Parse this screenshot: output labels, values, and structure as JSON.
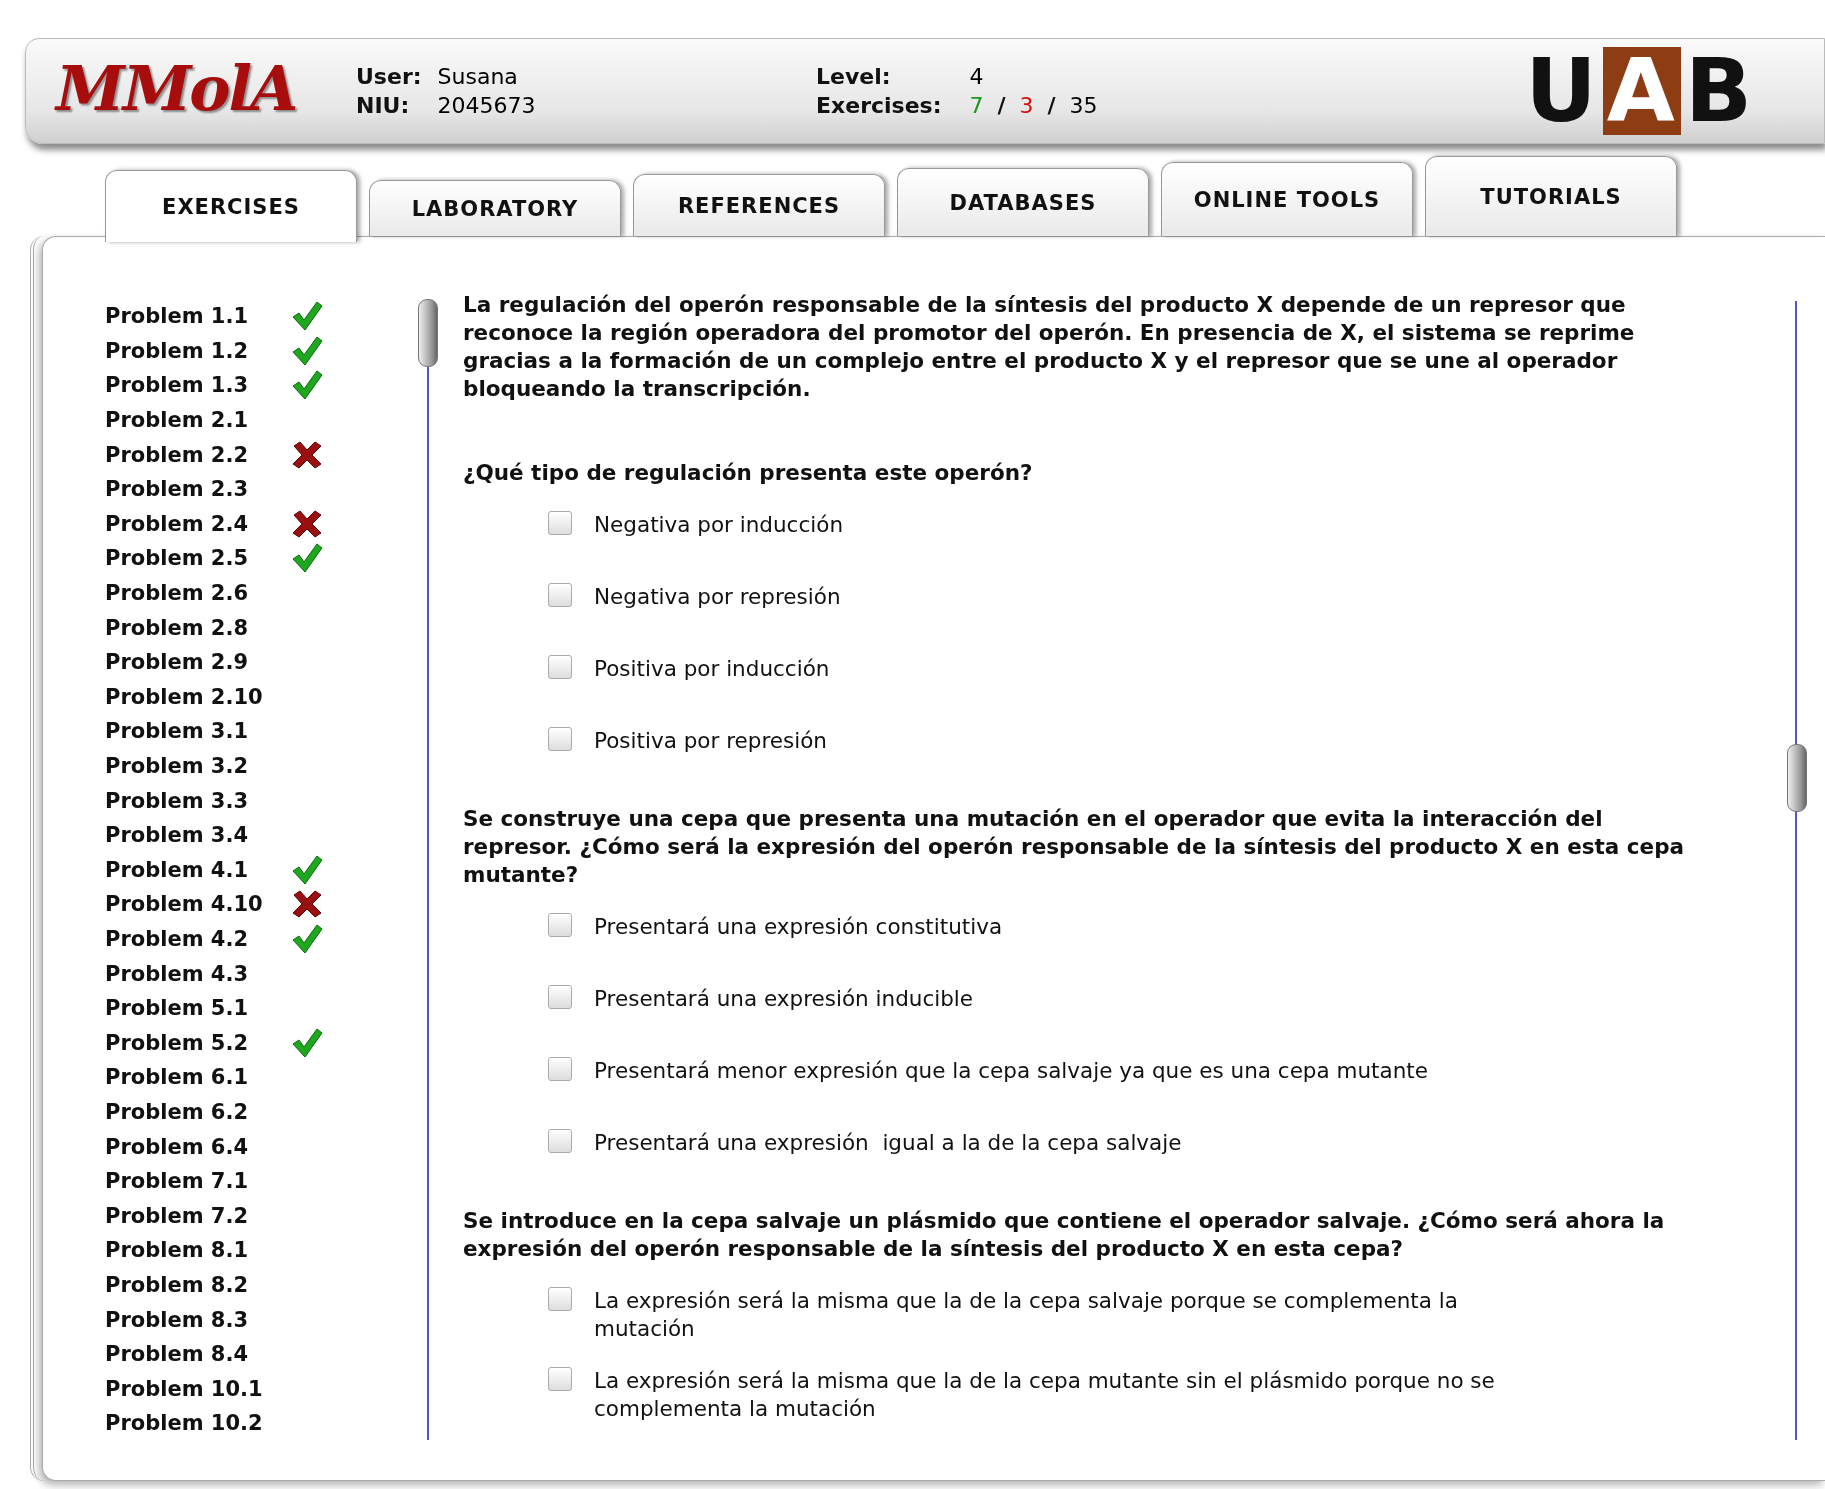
{
  "header": {
    "logo": "MMolA",
    "user_label": "User:",
    "user": "Susana",
    "niu_label": "NIU:",
    "niu": "2045673",
    "level_label": "Level:",
    "level_value": "4",
    "exercises_label": "Exercises:",
    "correct": "7",
    "wrong": "3",
    "total": "35",
    "sep1": "/",
    "sep2": "/",
    "brand": "UAB"
  },
  "tabs": [
    {
      "label": "EXERCISES",
      "selected": true
    },
    {
      "label": "LABORATORY",
      "selected": false
    },
    {
      "label": "REFERENCES",
      "selected": false
    },
    {
      "label": "DATABASES",
      "selected": false
    },
    {
      "label": "ONLINE TOOLS",
      "selected": false
    },
    {
      "label": "TUTORIALS",
      "selected": false
    }
  ],
  "problems": [
    {
      "label": "Problem 1.1",
      "kind": "correct"
    },
    {
      "label": "Problem 1.2",
      "kind": "correct"
    },
    {
      "label": "Problem 1.3",
      "kind": "correct"
    },
    {
      "label": "Problem 2.1",
      "kind": "none"
    },
    {
      "label": "Problem 2.2",
      "kind": "wrong"
    },
    {
      "label": "Problem 2.3",
      "kind": "none"
    },
    {
      "label": "Problem 2.4",
      "kind": "wrong"
    },
    {
      "label": "Problem 2.5",
      "kind": "correct"
    },
    {
      "label": "Problem 2.6",
      "kind": "none"
    },
    {
      "label": "Problem 2.8",
      "kind": "none"
    },
    {
      "label": "Problem 2.9",
      "kind": "none"
    },
    {
      "label": "Problem 2.10",
      "kind": "none"
    },
    {
      "label": "Problem 3.1",
      "kind": "none"
    },
    {
      "label": "Problem 3.2",
      "kind": "none"
    },
    {
      "label": "Problem 3.3",
      "kind": "none"
    },
    {
      "label": "Problem 3.4",
      "kind": "none"
    },
    {
      "label": "Problem 4.1",
      "kind": "correct"
    },
    {
      "label": "Problem 4.10",
      "kind": "wrong"
    },
    {
      "label": "Problem 4.2",
      "kind": "correct"
    },
    {
      "label": "Problem 4.3",
      "kind": "none"
    },
    {
      "label": "Problem 5.1",
      "kind": "none"
    },
    {
      "label": "Problem 5.2",
      "kind": "correct"
    },
    {
      "label": "Problem 6.1",
      "kind": "none"
    },
    {
      "label": "Problem 6.2",
      "kind": "none"
    },
    {
      "label": "Problem 6.4",
      "kind": "none"
    },
    {
      "label": "Problem 7.1",
      "kind": "none"
    },
    {
      "label": "Problem 7.2",
      "kind": "none"
    },
    {
      "label": "Problem 8.1",
      "kind": "none"
    },
    {
      "label": "Problem 8.2",
      "kind": "none"
    },
    {
      "label": "Problem 8.3",
      "kind": "none"
    },
    {
      "label": "Problem 8.4",
      "kind": "none"
    },
    {
      "label": "Problem 10.1",
      "kind": "none"
    },
    {
      "label": "Problem 10.2",
      "kind": "none"
    }
  ],
  "passage": "La regulación del operón responsable de la síntesis del producto X depende de un represor que reconoce la región operadora del promotor del operón. En presencia de X, el sistema se reprime gracias a la formación de un complejo entre el producto X y el represor que se une al operador bloqueando la transcripción.",
  "questions": [
    {
      "text": "¿Qué tipo de regulación presenta este operón?",
      "options": [
        {
          "label": "Negativa por inducción",
          "checked": false
        },
        {
          "label": "Negativa por represión",
          "checked": false
        },
        {
          "label": "Positiva por inducción",
          "checked": false
        },
        {
          "label": "Positiva por represión",
          "checked": false
        }
      ]
    },
    {
      "text": "Se construye una cepa que presenta una mutación en el operador que evita la interacción del represor. ¿Cómo será la expresión del operón responsable de la síntesis del producto X en esta cepa mutante?",
      "options": [
        {
          "label": "Presentará una expresión constitutiva",
          "checked": false
        },
        {
          "label": "Presentará una expresión inducible",
          "checked": false
        },
        {
          "label": "Presentará menor expresión que la cepa salvaje ya que es una cepa mutante",
          "checked": false
        },
        {
          "label": "Presentará una expresión  igual a la de la cepa salvaje",
          "checked": false
        }
      ]
    },
    {
      "text": "Se introduce en la cepa salvaje un plásmido que contiene el operador salvaje. ¿Cómo será ahora la expresión del operón responsable de la síntesis del producto X en esta cepa?",
      "options": [
        {
          "label": "La expresión será la misma que la de la cepa salvaje porque se complementa la mutación",
          "checked": false
        },
        {
          "label": "La expresión será la misma que la de la cepa mutante sin el plásmido porque no se complementa la mutación",
          "checked": false
        }
      ]
    }
  ]
}
